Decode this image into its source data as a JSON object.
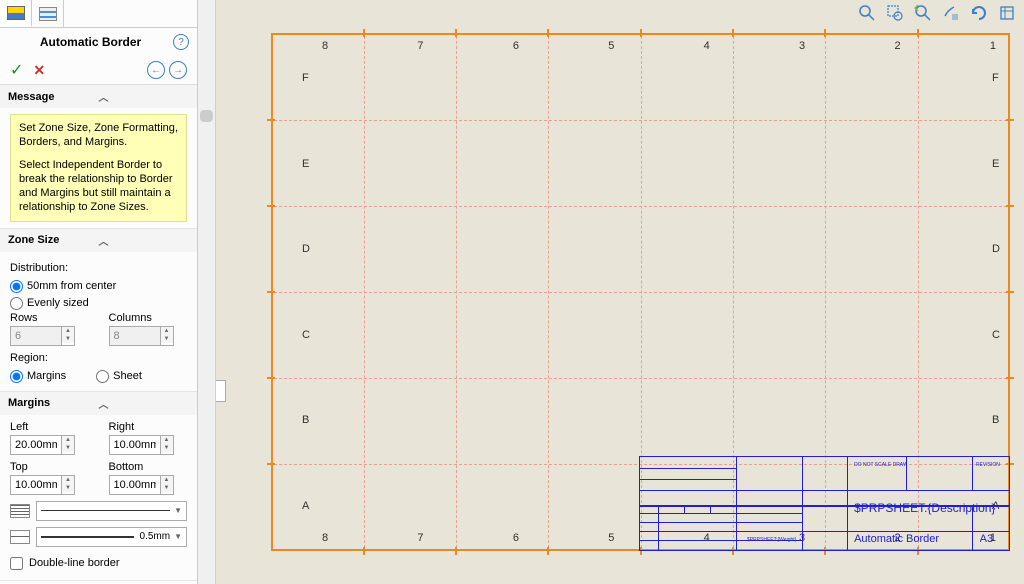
{
  "panel": {
    "title": "Automatic Border",
    "help_tooltip": "?",
    "ok_tooltip": "✓",
    "cancel_tooltip": "✕",
    "prev": "←",
    "next": "→"
  },
  "message": {
    "title": "Message",
    "line1": "Set Zone Size, Zone Formatting, Borders, and Margins.",
    "line2": "Select Independent Border to break the relationship to Border and Margins but still maintain a relationship to Zone Sizes."
  },
  "zone": {
    "title": "Zone Size",
    "dist_label": "Distribution:",
    "dist_center": "50mm from center",
    "dist_even": "Evenly sized",
    "rows_label": "Rows",
    "rows_value": "6",
    "cols_label": "Columns",
    "cols_value": "8",
    "region_label": "Region:",
    "region_margins": "Margins",
    "region_sheet": "Sheet"
  },
  "margins": {
    "title": "Margins",
    "left_label": "Left",
    "left_value": "20.00mm",
    "right_label": "Right",
    "right_value": "10.00mm",
    "top_label": "Top",
    "top_value": "10.00mm",
    "bottom_label": "Bottom",
    "bottom_value": "10.00mm",
    "thickness_label": "0.5mm",
    "double_line": "Double-line border"
  },
  "sheet": {
    "col_labels": [
      "8",
      "7",
      "6",
      "5",
      "4",
      "3",
      "2",
      "1"
    ],
    "row_labels": [
      "A",
      "B",
      "C",
      "D",
      "E",
      "F"
    ]
  },
  "titleblock": {
    "t1": "$PRPSHEET:{Description}",
    "t2": "Automatic Border",
    "t3": "A3",
    "t4": "$PRPSHEET:{Weight}",
    "t5": "DO NOT SCALE DRAWING",
    "t6": "REVISION"
  }
}
